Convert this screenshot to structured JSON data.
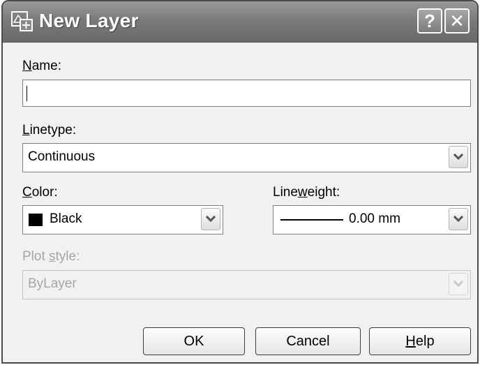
{
  "window": {
    "title": "New Layer",
    "help_label": "?",
    "close_label": "✕"
  },
  "name": {
    "label_mnemonic": "N",
    "label_rest": "ame:",
    "value": ""
  },
  "linetype": {
    "label_mnemonic": "L",
    "label_rest": "inetype:",
    "selected": "Continuous"
  },
  "color": {
    "label_mnemonic": "C",
    "label_rest": "olor:",
    "selected": "Black",
    "swatch": "#000000"
  },
  "lineweight": {
    "label_pre": "Line",
    "label_mnemonic": "w",
    "label_rest": "eight:",
    "selected": "0.00 mm"
  },
  "plot_style": {
    "label_pre": "Plot ",
    "label_mnemonic": "s",
    "label_rest": "tyle:",
    "selected": "ByLayer",
    "enabled": false
  },
  "buttons": {
    "ok": "OK",
    "cancel": "Cancel",
    "help_mnemonic": "H",
    "help_rest": "elp"
  },
  "icons": {
    "title": "layer-icon",
    "dropdown": "chevron-down-icon"
  }
}
